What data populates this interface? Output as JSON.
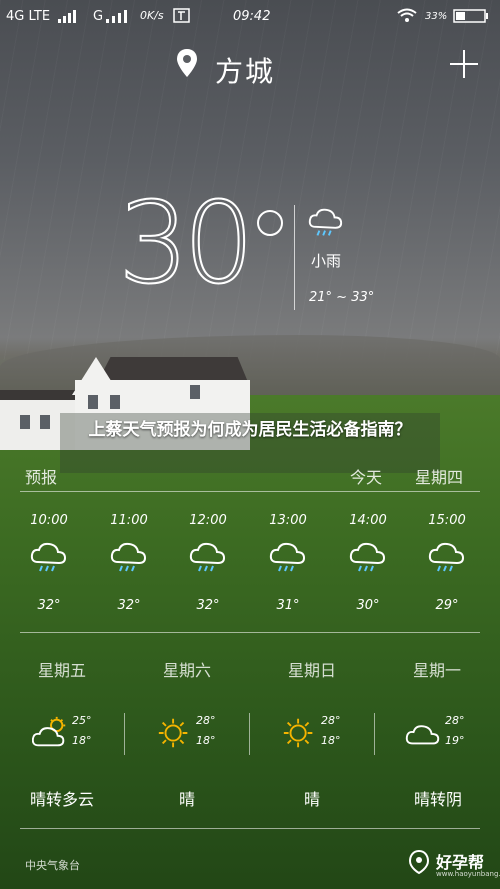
{
  "status_bar": {
    "network1": "4G LTE",
    "network2": "G",
    "speed": "0K/s",
    "time": "09:42",
    "battery": "33%"
  },
  "header": {
    "city": "方城"
  },
  "current": {
    "temperature": "30",
    "description": "小雨",
    "range": "21° ~ 33°",
    "icon": "light-rain-icon"
  },
  "caption": "上蔡天气预报为何成为居民生活必备指南？",
  "forecast": {
    "label": "预报",
    "today": "今天",
    "weekday": "星期四",
    "hours": [
      {
        "time": "10:00",
        "temp": "32°",
        "icon": "rain-icon"
      },
      {
        "time": "11:00",
        "temp": "32°",
        "icon": "rain-icon"
      },
      {
        "time": "12:00",
        "temp": "32°",
        "icon": "rain-icon"
      },
      {
        "time": "13:00",
        "temp": "31°",
        "icon": "rain-icon"
      },
      {
        "time": "14:00",
        "temp": "30°",
        "icon": "rain-icon"
      },
      {
        "time": "15:00",
        "temp": "29°",
        "icon": "rain-icon"
      }
    ]
  },
  "days": [
    {
      "name": "星期五",
      "hi": "25°",
      "lo": "18°",
      "desc": "晴转多云",
      "icon": "partly-cloudy-icon"
    },
    {
      "name": "星期六",
      "hi": "28°",
      "lo": "18°",
      "desc": "晴",
      "icon": "sun-icon"
    },
    {
      "name": "星期日",
      "hi": "28°",
      "lo": "18°",
      "desc": "晴",
      "icon": "sun-icon"
    },
    {
      "name": "星期一",
      "hi": "28°",
      "lo": "19°",
      "desc": "晴转阴",
      "icon": "cloud-icon"
    }
  ],
  "footer": {
    "source": "中央气象台"
  },
  "watermark": {
    "brand": "好孕帮",
    "sub": "www.haoyunbang.com"
  },
  "colors": {
    "text": "#ffffff",
    "sky": "#5b5e63",
    "grass": "#3c6b22"
  }
}
